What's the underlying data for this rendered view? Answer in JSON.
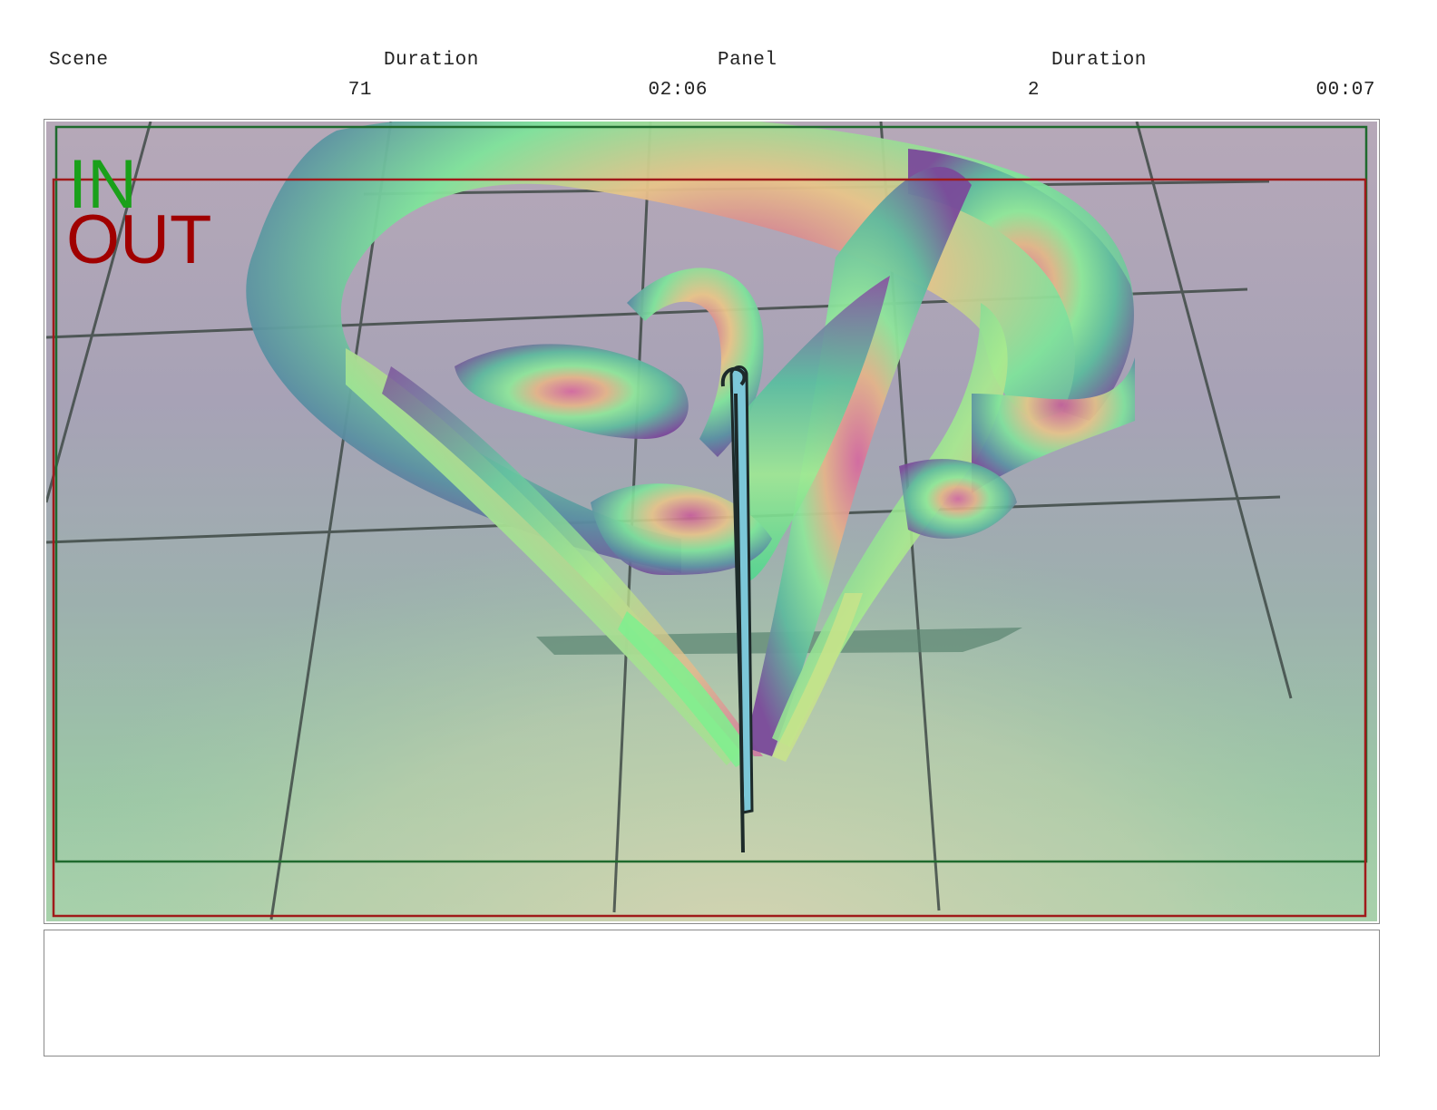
{
  "header": {
    "scene_label": "Scene",
    "scene_value": "71",
    "scene_duration_label": "Duration",
    "scene_duration_value": "02:06",
    "panel_label": "Panel",
    "panel_value": "2",
    "panel_duration_label": "Duration",
    "panel_duration_value": "00:07"
  },
  "frame": {
    "in_label": "IN",
    "out_label": "OUT",
    "in_color": "#1aa01a",
    "out_color": "#a00000"
  },
  "notes": {
    "text": ""
  }
}
